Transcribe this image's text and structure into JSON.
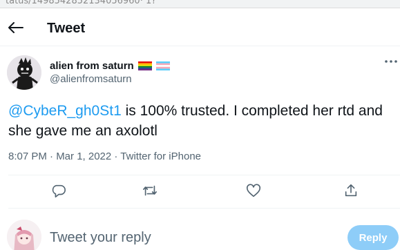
{
  "browser": {
    "url_fragment": "tatus/1498542852134056960· 1?"
  },
  "header": {
    "title": "Tweet"
  },
  "tweet": {
    "author_name": "alien from saturn",
    "author_handle": "@alienfromsaturn",
    "flags": [
      "rainbow-flag-icon",
      "transgender-flag-icon"
    ],
    "mention": "@CybeR_gh0St1",
    "text_rest": " is 100% trusted. I completed her rtd and she gave me an axolotl",
    "timestamp": "8:07 PM · Mar 1, 2022 · Twitter for iPhone"
  },
  "actions": [
    "reply-icon",
    "retweet-icon",
    "like-icon",
    "share-icon"
  ],
  "reply": {
    "placeholder": "Tweet your reply",
    "button_label": "Reply"
  },
  "colors": {
    "accent": "#1d9bf0",
    "reply_button_disabled": "#8ecdf8",
    "secondary_text": "#536471"
  }
}
